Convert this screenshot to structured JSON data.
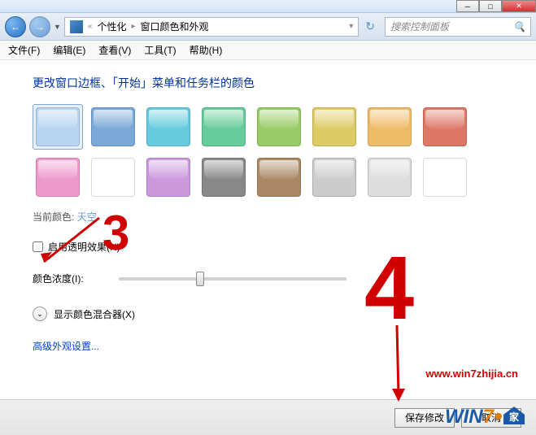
{
  "window": {
    "min_icon": "─",
    "max_icon": "□",
    "close_icon": "✕"
  },
  "nav": {
    "back_glyph": "←",
    "fwd_glyph": "→",
    "bc_prefix": "«",
    "bc_item1": "个性化",
    "bc_item2": "窗口颜色和外观",
    "search_placeholder": "搜索控制面板",
    "refresh_glyph": "↻"
  },
  "menu": {
    "file": "文件(F)",
    "edit": "编辑(E)",
    "view": "查看(V)",
    "tools": "工具(T)",
    "help": "帮助(H)"
  },
  "page": {
    "heading": "更改窗口边框、「开始」菜单和任务栏的颜色",
    "current_label": "当前颜色:",
    "current_name": "天空",
    "checkbox_label": "启用透明效果(N)",
    "slider_label": "颜色浓度(I):",
    "expander_label": "显示颜色混合器(X)",
    "adv_link": "高级外观设置...",
    "swatches_row1": [
      "#b8d4f0",
      "#7aa8d8",
      "#66ccdd",
      "#66cc99",
      "#99cc66",
      "#ddcc66",
      "#eebb66",
      "#dd7766"
    ],
    "swatches_row2": [
      "#ee99cc",
      "#ffffff",
      "#cc99dd",
      "#888888",
      "#aa8866",
      "#cccccc",
      "#dddddd",
      "#ffffff"
    ],
    "selected_index": 0
  },
  "footer": {
    "save": "保存修改",
    "cancel": "取消"
  },
  "annotations": {
    "num3": "3",
    "num4": "4",
    "watermark_url": "www.win7zhijia.cn",
    "logo_w": "W",
    "logo_i": "I",
    "logo_n": "N",
    "logo_7": "7"
  }
}
